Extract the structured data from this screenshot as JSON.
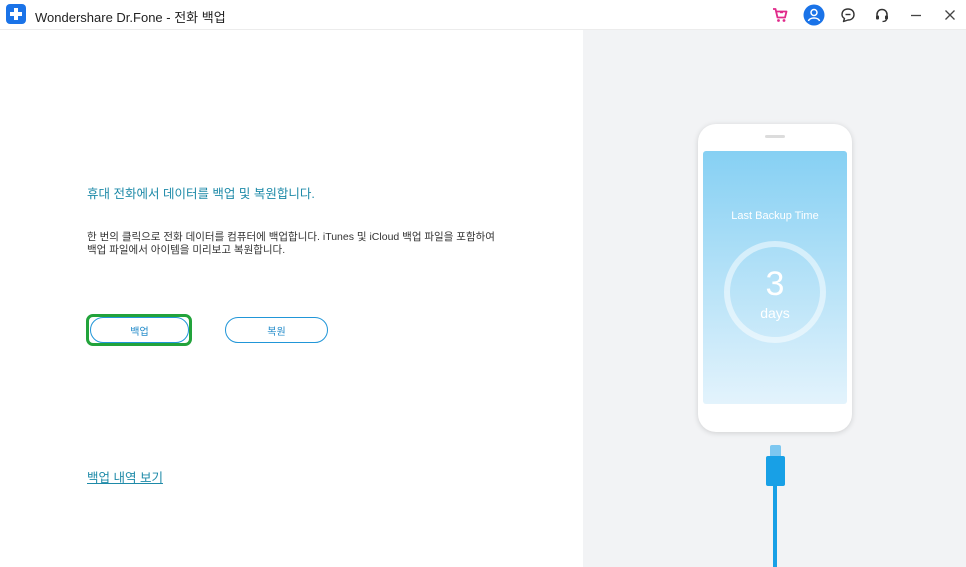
{
  "window": {
    "title": "Wondershare Dr.Fone - 전화 백업"
  },
  "titlebar": {
    "icons": [
      "cart-icon",
      "account-icon",
      "feedback-icon",
      "support-icon",
      "minimize-icon",
      "close-icon"
    ],
    "accent_colors": {
      "cart": "#e0298a",
      "account": "#1a73e8"
    }
  },
  "main": {
    "headline": "휴대 전화에서 데이터를 백업 및 복원합니다.",
    "description": "한 번의 클릭으로 전화 데이터를 컴퓨터에 백업합니다. iTunes 및 iCloud 백업 파일을 포함하여 백업 파일에서 아이템을 미리보고 복원합니다.",
    "backup_button": "백업",
    "restore_button": "복원",
    "history_link": "백업 내역 보기"
  },
  "illustration": {
    "label": "Last Backup Time",
    "value": "3",
    "unit": "days"
  },
  "colors": {
    "accent": "#1e8aa8",
    "button_border": "#2196d8",
    "highlight": "#22a33b",
    "right_panel": "#f2f3f5"
  }
}
